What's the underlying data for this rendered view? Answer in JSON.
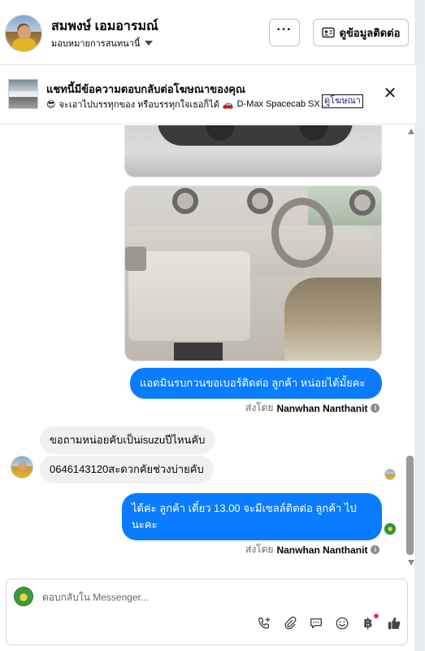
{
  "header": {
    "name": "สมพงษ์ เอมอารมณ์",
    "assign_label": "มอบหมายการสนทนานี้",
    "more_label": "···",
    "info_button_label": "ดูข้อมูลติดต่อ"
  },
  "banner": {
    "title": "แชทนี้มีข้อความตอบกลับต่อโฆษณาของคุณ",
    "emoji": "😎",
    "subtitle": "จะเอาไปบรรทุกของ หรือบรรทุกใจเธอก็ได้",
    "car_emoji": "🚗",
    "ad_name": "D-Max Spacecab SX ...",
    "link_label": "ดูโฆษณา",
    "close_label": "✕"
  },
  "messages": {
    "out1": "แอดมินรบกวนขอเบอร์ติดต่อ ลูกค้า หน่อยได้มั้ยคะ",
    "sent_by_prefix": "ส่งโดย",
    "sent_by_name": "Nanwhan Nanthanit",
    "in1": "ขอถามหน่อยคับเป็นisuzuปีไหนคับ",
    "in2": "0646143120สะดวกคัยช่วงบ่ายคับ",
    "out2_line1": "ได้ค่ะ ลูกค้า เดี๋ยว 13.00 จะมีเซลล์ติดต่อ ลูกค้า ไป",
    "out2_line2": "นะคะ"
  },
  "composer": {
    "placeholder": "ตอบกลับใน Messenger...",
    "baht_symbol": "฿"
  },
  "colors": {
    "accent": "#0a7cff",
    "incoming_bubble": "#f0f0f0",
    "notification_dot": "#e8375a"
  },
  "icons": [
    "more-dots-icon",
    "contact-card-icon",
    "close-icon",
    "call-add-icon",
    "attach-icon",
    "chat-bubble-icon",
    "emoji-icon",
    "baht-icon",
    "thumbs-up-icon",
    "info-icon"
  ]
}
